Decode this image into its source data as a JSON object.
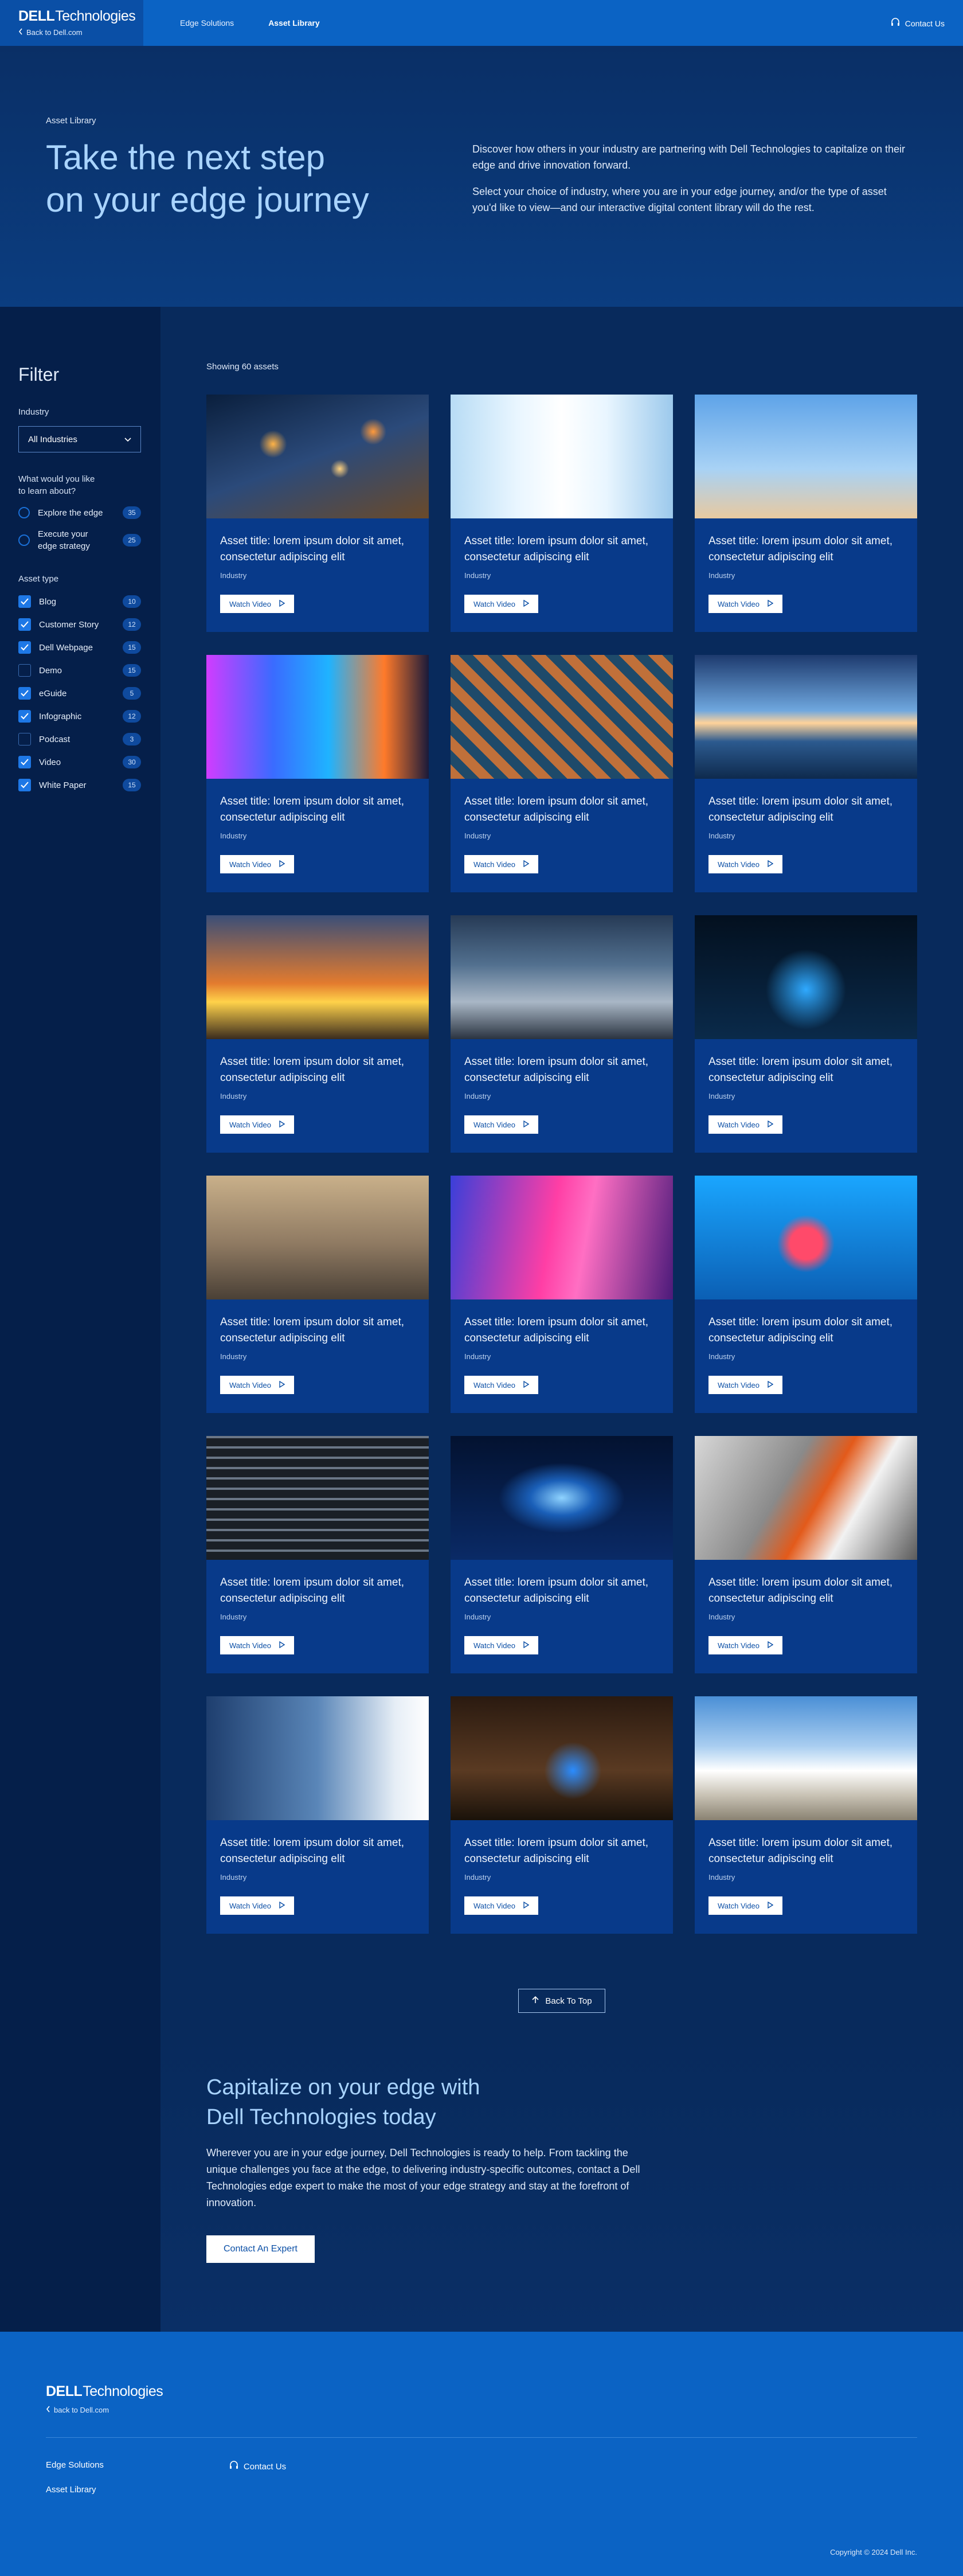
{
  "nav": {
    "logo_bold": "DELL",
    "logo_light": "Technologies",
    "back_label": "Back to Dell.com",
    "links": [
      "Edge Solutions",
      "Asset Library"
    ],
    "contact_label": "Contact Us"
  },
  "hero": {
    "eyebrow": "Asset Library",
    "title_line1": "Take the next step",
    "title_line2": "on your edge journey",
    "para1": "Discover how others in your industry are partnering with Dell Technologies to capitalize on their edge and drive innovation forward.",
    "para2": "Select your choice of industry, where you are in your edge journey, and/or the type of asset you'd like to view—and our interactive digital content library will do the rest."
  },
  "filter": {
    "title": "Filter",
    "industry_label": "Industry",
    "industry_value": "All Industries",
    "learn_label_line1": "What would you like",
    "learn_label_line2": "to learn about?",
    "learn_options": [
      {
        "label": "Explore the edge",
        "count": "35"
      },
      {
        "label": "Execute your edge strategy",
        "count": "25"
      }
    ],
    "asset_type_label": "Asset type",
    "asset_types": [
      {
        "label": "Blog",
        "count": "10",
        "checked": true
      },
      {
        "label": "Customer Story",
        "count": "12",
        "checked": true
      },
      {
        "label": "Dell Webpage",
        "count": "15",
        "checked": true
      },
      {
        "label": "Demo",
        "count": "15",
        "checked": false
      },
      {
        "label": "eGuide",
        "count": "5",
        "checked": true
      },
      {
        "label": "Infographic",
        "count": "12",
        "checked": true
      },
      {
        "label": "Podcast",
        "count": "3",
        "checked": false
      },
      {
        "label": "Video",
        "count": "30",
        "checked": true
      },
      {
        "label": "White Paper",
        "count": "15",
        "checked": true
      }
    ]
  },
  "results": {
    "showing": "Showing 60 assets",
    "card_title": "Asset title: lorem ipsum dolor sit amet, consectetur adipiscing elit",
    "card_industry": "Industry",
    "card_button": "Watch Video",
    "cards": [
      {
        "icon": "city-night-image"
      },
      {
        "icon": "corridor-people-image"
      },
      {
        "icon": "skyscrapers-person-image"
      },
      {
        "icon": "server-room-neon-image"
      },
      {
        "icon": "stairwell-spiral-image"
      },
      {
        "icon": "earth-horizon-image"
      },
      {
        "icon": "wind-turbines-image"
      },
      {
        "icon": "industrial-plant-image"
      },
      {
        "icon": "robot-arms-car-image"
      },
      {
        "icon": "cell-tower-image"
      },
      {
        "icon": "fiber-optics-image"
      },
      {
        "icon": "digital-heart-image"
      },
      {
        "icon": "network-cables-image"
      },
      {
        "icon": "data-tunnel-people-image"
      },
      {
        "icon": "factory-worker-image"
      },
      {
        "icon": "businesswoman-image"
      },
      {
        "icon": "smartphone-hand-image"
      },
      {
        "icon": "satellite-dish-image"
      }
    ]
  },
  "back_to_top": "Back To Top",
  "cta": {
    "title_line1": "Capitalize on your edge with",
    "title_line2": "Dell Technologies today",
    "text": "Wherever you are in your edge journey, Dell Technologies is ready to help. From tackling the unique challenges you face at the edge, to delivering industry-specific outcomes, contact a Dell Technologies edge expert to make the most of your edge strategy and stay at the forefront of innovation.",
    "button": "Contact An Expert"
  },
  "footer": {
    "back_label": "back to Dell.com",
    "links": [
      "Edge Solutions",
      "Asset Library"
    ],
    "contact_label": "Contact Us",
    "copyright": "Copyright © 2024 Dell Inc."
  }
}
